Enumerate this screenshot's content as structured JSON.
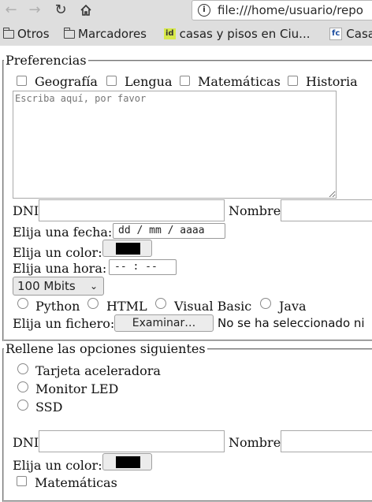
{
  "browser": {
    "url": "file:///home/usuario/repo",
    "bookmarks": [
      "Otros",
      "Marcadores",
      "casas y pisos en Ciu...",
      "Casa"
    ],
    "favicons": [
      "id",
      "fc"
    ]
  },
  "fieldset1": {
    "legend": "Preferencias",
    "checkboxes": [
      "Geografía",
      "Lengua",
      "Matemáticas",
      "Historia"
    ],
    "textarea_placeholder": "Escriba aquí, por favor",
    "dni_label": "DNI",
    "nombre_label": "Nombre",
    "fecha_label": "Elija una fecha:",
    "fecha_placeholder": "dd / mm / aaaa",
    "color_label": "Elija un color:",
    "color_value": "#000000",
    "hora_label": "Elija una hora:",
    "hora_placeholder": "-- : --",
    "select_value": "100 Mbits",
    "radios": [
      "Python",
      "HTML",
      "Visual Basic",
      "Java"
    ],
    "fichero_label": "Elija un fichero:",
    "fichero_button": "Examinar…",
    "fichero_status": "No se ha seleccionado ni"
  },
  "fieldset2": {
    "legend": "Rellene las opciones siguientes",
    "radios": [
      "Tarjeta aceleradora",
      "Monitor LED",
      "SSD"
    ],
    "dni_label": "DNI",
    "nombre_label": "Nombre",
    "color_label": "Elija un color:",
    "color_value": "#000000",
    "checkbox": "Matemáticas"
  }
}
